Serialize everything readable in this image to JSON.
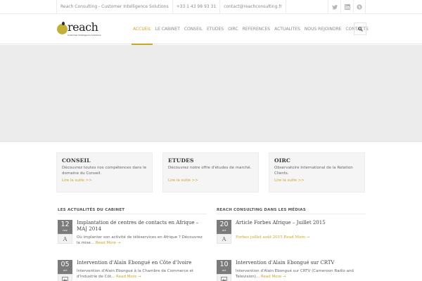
{
  "topbar": {
    "company": "Reach Consulting - Customer Intelligence Solutions",
    "phone": "+33 1 43 98 93 31",
    "email": "contact@reachconsulting.fr",
    "social": [
      "twitter-icon",
      "linkedin-icon",
      "skype-icon"
    ]
  },
  "logo": {
    "word": "reach",
    "tagline": "Customer Intelligence Solutions"
  },
  "nav": {
    "items": [
      "ACCUEIL",
      "LE CABINET",
      "CONSEIL",
      "ETUDES",
      "OIRC",
      "REFERENCES",
      "ACTUALITES",
      "NOUS REJOINDRE",
      "CONTACTS"
    ],
    "active": "ACCUEIL",
    "accent": "#c9a627"
  },
  "features": [
    {
      "title": "CONSEIL",
      "desc": "Découvrez toutes nos compétences dans le domaine du Conseil.",
      "more": "Lire la suite >>"
    },
    {
      "title": "ETUDES",
      "desc": "Découvrez notre offre d'études de marché.",
      "more": "Lire la suite >>"
    },
    {
      "title": "OIRC",
      "desc": "Observatoire International de la Relation Clients.",
      "more": "Lire la suite >>"
    }
  ],
  "news_left": {
    "heading": "LES ACTUALITÉS DU CABINET",
    "posts": [
      {
        "day": "12",
        "month": "nov",
        "type": "A",
        "title": "Implantation de centres de contacts en Afrique – MAJ 2014",
        "excerpt": "Où implanter son activité de téléservices en Afrique ? Découvrez la mise...",
        "more": "Read More →"
      },
      {
        "day": "05",
        "month": "oct",
        "type": "image-icon",
        "title": "Intervention d'Alain Ebongué en Côte d'Ivoire",
        "excerpt": "Intervention d'Alain Ebongué à la Chambre de Commerce et d'Industrie de Côt...",
        "more": "Read More →"
      }
    ]
  },
  "news_right": {
    "heading": "REACH CONSULTING DANS LES MÉDIAS",
    "posts": [
      {
        "day": "20",
        "month": "oct",
        "type": "A",
        "title": "Article Forbes Afrique – Juillet 2015",
        "excerpt": "Forbes juillet août 2015",
        "more": "Read More →"
      },
      {
        "day": "10",
        "month": "oct",
        "type": "image-icon",
        "title": "Intervention d'Alain Ebongué sur CRTV",
        "excerpt": "Intervention d'Alain Ebongué sur CRTV (Cameroon Radio and Television)...",
        "more": "Read More →"
      }
    ]
  }
}
